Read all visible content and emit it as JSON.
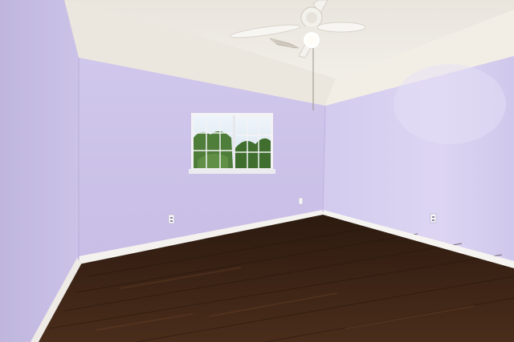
{
  "scene": {
    "subject": "empty room",
    "colors": {
      "wall_left": "#c9c0e6",
      "wall_back": "#d2c9ec",
      "wall_right": "#d8d0ef",
      "ceiling": "#f1ede6",
      "floor": "#3e2516",
      "baseboard": "#f4f2ef"
    },
    "icons": [
      "ceiling-fan-icon",
      "window-icon",
      "outlet-icon",
      "air-vent-icon"
    ]
  }
}
